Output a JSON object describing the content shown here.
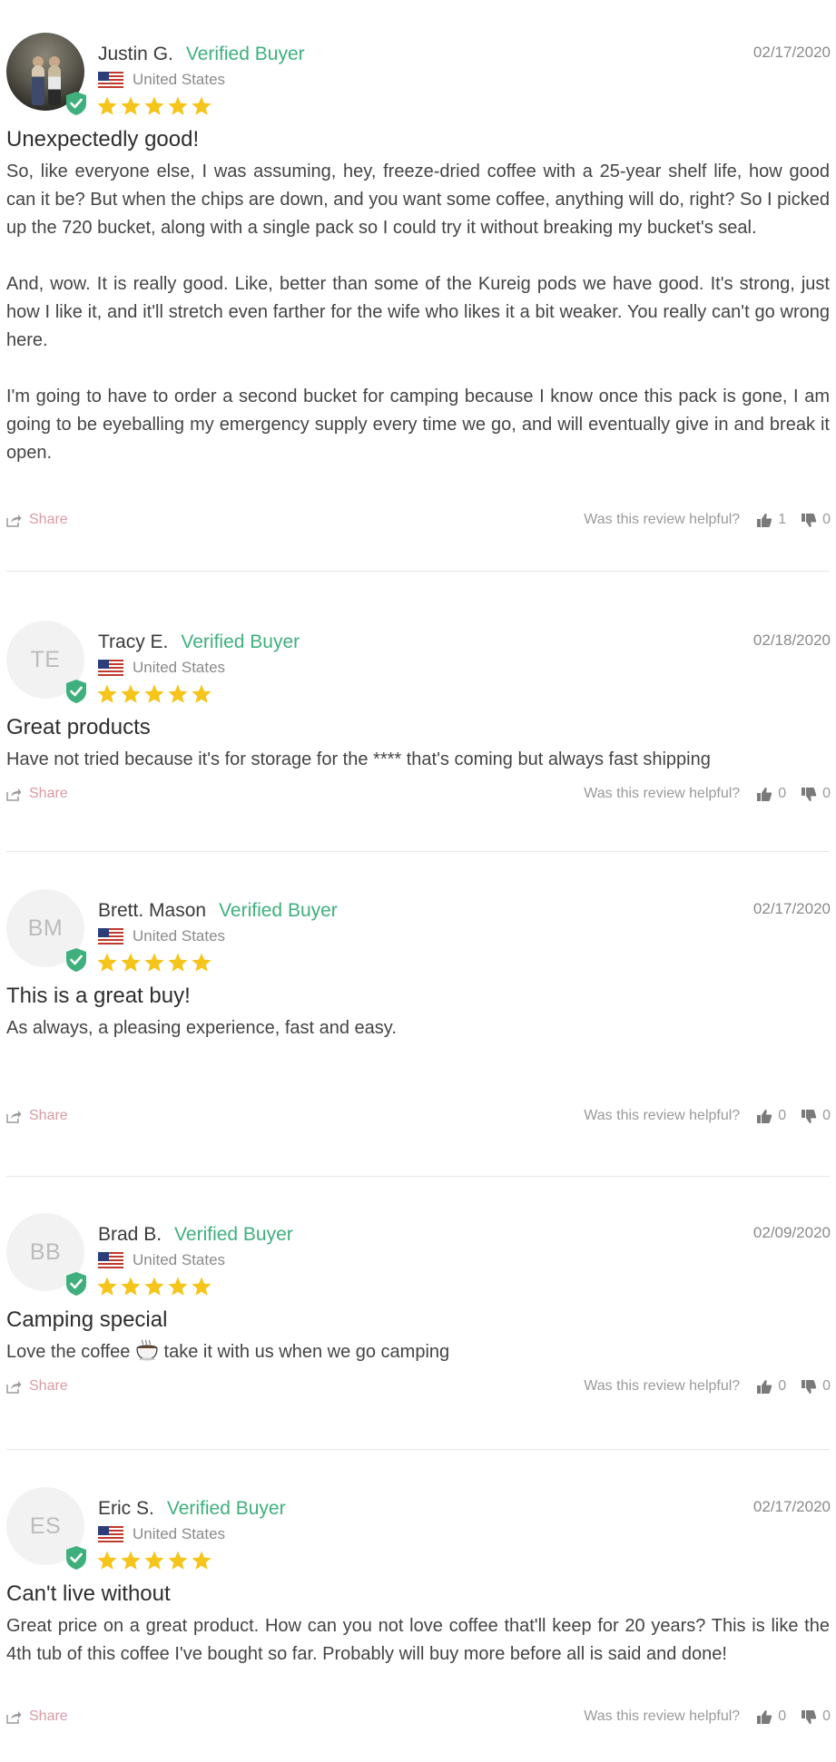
{
  "colors": {
    "verified": "#3fb07d",
    "star": "#f5c51b",
    "share": "#d99aa5",
    "badge": "#3fb07d"
  },
  "helpful_question": "Was this review helpful?",
  "share_label": "Share",
  "reviews": [
    {
      "author": "Justin G.",
      "verified_label": "Verified Buyer",
      "country": "United States",
      "date": "02/17/2020",
      "rating": 5,
      "avatar": "photo",
      "title": "Unexpectedly good!",
      "paragraphs": [
        "So, like everyone else, I was assuming, hey, freeze-dried coffee with a 25-year shelf life, how good can it be? But when the chips are down, and you want some coffee, anything will do, right? So I picked up the 720 bucket, along with a single pack so I could try it without breaking my bucket's seal.",
        "And, wow. It is really good. Like, better than some of the Kureig pods we have good. It's strong, just how I like it, and it'll stretch even farther for the wife who likes it a bit weaker. You really can't go wrong here.",
        "I'm going to have to order a second bucket for camping because I know once this pack is gone, I am going to be eyeballing my emergency supply every time we go, and will eventually give in and break it open."
      ],
      "up_votes": "1",
      "down_votes": "0"
    },
    {
      "author": "Tracy E.",
      "verified_label": "Verified Buyer",
      "country": "United States",
      "date": "02/18/2020",
      "rating": 5,
      "initials": "TE",
      "title": "Great products",
      "paragraphs": [
        "Have not tried because it's for storage for the **** that's coming but always fast shipping"
      ],
      "up_votes": "0",
      "down_votes": "0"
    },
    {
      "author": "Brett. Mason",
      "verified_label": "Verified Buyer",
      "country": "United States",
      "date": "02/17/2020",
      "rating": 5,
      "initials": "BM",
      "title": "This is a great buy!",
      "paragraphs": [
        "As always, a pleasing experience, fast and easy."
      ],
      "up_votes": "0",
      "down_votes": "0"
    },
    {
      "author": "Brad B.",
      "verified_label": "Verified Buyer",
      "country": "United States",
      "date": "02/09/2020",
      "rating": 5,
      "initials": "BB",
      "title": "Camping special",
      "body_before_emoji": "Love the coffee",
      "emoji": "coffee-cup-icon",
      "body_after_emoji": "take it with us when we go camping",
      "up_votes": "0",
      "down_votes": "0"
    },
    {
      "author": "Eric S.",
      "verified_label": "Verified Buyer",
      "country": "United States",
      "date": "02/17/2020",
      "rating": 5,
      "initials": "ES",
      "title": "Can't live without",
      "paragraphs": [
        "Great price on a great product. How can you not love coffee that'll keep for 20 years? This is like the 4th tub of this coffee I've bought so far. Probably will buy more before all is said and done!"
      ],
      "up_votes": "0",
      "down_votes": "0"
    }
  ]
}
